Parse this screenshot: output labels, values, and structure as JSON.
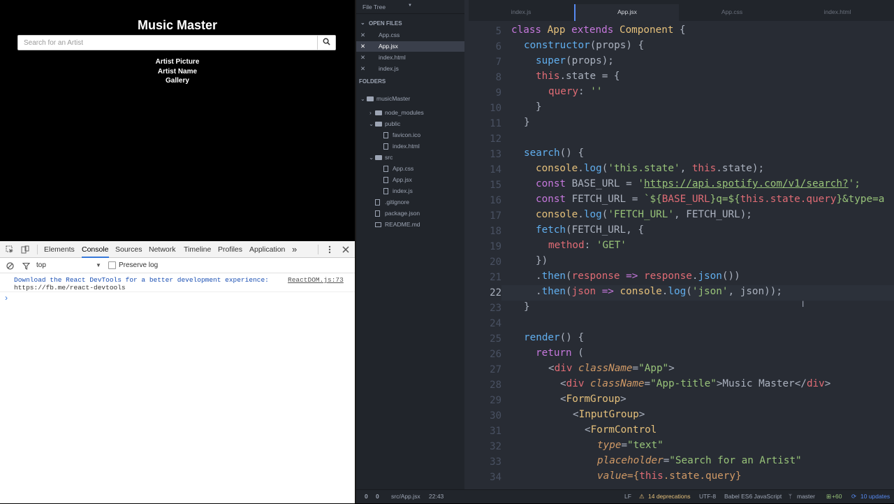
{
  "browser": {
    "app_title": "Music Master",
    "search_placeholder": "Search for an Artist",
    "lines": [
      "Artist Picture",
      "Artist Name",
      "Gallery"
    ]
  },
  "devtools": {
    "tabs": [
      "Elements",
      "Console",
      "Sources",
      "Network",
      "Timeline",
      "Profiles",
      "Application"
    ],
    "active_tab": "Console",
    "more_tabs": "»",
    "context": "top",
    "preserve_log": "Preserve log",
    "message": "Download the React DevTools for a better development experience:",
    "message_link": "https://fb.me/react-devtools",
    "message_source": "ReactDOM.js:73",
    "prompt": "›"
  },
  "editor": {
    "tree_header": "File Tree",
    "open_files_label": "OPEN FILES",
    "open_files": [
      "App.css",
      "App.jsx",
      "index.html",
      "index.js"
    ],
    "folders_label": "FOLDERS",
    "project": "musicMaster",
    "tree_items": {
      "node_modules": "node_modules",
      "public": "public",
      "favicon": "favicon.ico",
      "index_html": "index.html",
      "src": "src",
      "app_css": "App.css",
      "app_jsx": "App.jsx",
      "index_js": "index.js",
      "gitignore": ".gitignore",
      "package_json": "package.json",
      "readme": "README.md"
    },
    "tabs": [
      "index.js",
      "App.jsx",
      "App.css",
      "index.html"
    ],
    "active_tab": "App.jsx",
    "line_numbers": [
      "5",
      "6",
      "7",
      "8",
      "9",
      "10",
      "11",
      "12",
      "13",
      "14",
      "15",
      "16",
      "17",
      "18",
      "19",
      "20",
      "21",
      "22",
      "23",
      "24",
      "25",
      "26",
      "27",
      "28",
      "29",
      "30",
      "31",
      "32",
      "33",
      "34"
    ],
    "current_line": "22",
    "code": {
      "l5": [
        "class ",
        "App ",
        "extends ",
        "Component",
        " {"
      ],
      "l6": [
        "constructor",
        "(props) {"
      ],
      "l7": [
        "super",
        "(props);"
      ],
      "l8": [
        "this",
        ".state = {"
      ],
      "l9": [
        "query",
        ": ",
        "''"
      ],
      "l10": [
        "}"
      ],
      "l11": [
        "}"
      ],
      "l13": [
        "search",
        "() {"
      ],
      "l14": [
        "console",
        ".",
        "log",
        "(",
        "'this.state'",
        ", ",
        "this",
        ".state);"
      ],
      "l15": [
        "const ",
        "BASE_URL",
        " = ",
        "'",
        "https://api.spotify.com/v1/search?",
        "';"
      ],
      "l16": [
        "const ",
        "FETCH_URL",
        " = ",
        "`${",
        "BASE_URL",
        "}q=${",
        "this",
        ".state.query",
        "}&type=a"
      ],
      "l17": [
        "console",
        ".",
        "log",
        "(",
        "'FETCH_URL'",
        ", ",
        "FETCH_URL",
        ");"
      ],
      "l18": [
        "fetch",
        "(",
        "FETCH_URL",
        ", {"
      ],
      "l19": [
        "method",
        ": ",
        "'GET'"
      ],
      "l20": [
        "})"
      ],
      "l21": [
        ".",
        "then",
        "(",
        "response",
        " => ",
        "response",
        ".",
        "json",
        "())"
      ],
      "l22": [
        ".",
        "then",
        "(",
        "json",
        " => ",
        "console",
        ".",
        "log",
        "(",
        "'json'",
        ", ",
        "json",
        "));"
      ],
      "l23": [
        "}"
      ],
      "l25": [
        "render",
        "() {"
      ],
      "l26": [
        "return",
        " ("
      ],
      "l27": [
        "<",
        "div ",
        "className",
        "=",
        "\"App\"",
        ">"
      ],
      "l28": [
        "<",
        "div ",
        "className",
        "=",
        "\"App-title\"",
        ">Music Master</",
        "div",
        ">"
      ],
      "l29": [
        "<",
        "FormGroup",
        ">"
      ],
      "l30": [
        "<",
        "InputGroup",
        ">"
      ],
      "l31": [
        "<",
        "FormControl"
      ],
      "l32": [
        "type",
        "=",
        "\"text\""
      ],
      "l33": [
        "placeholder",
        "=",
        "\"Search for an Artist\""
      ],
      "l34": [
        "value",
        "={",
        "this",
        ".state.query",
        "}"
      ]
    },
    "status": {
      "errors": "0",
      "warnings": "0",
      "file": "src/App.jsx",
      "cursor": "22:43",
      "line_ending": "LF",
      "deprecations": "14 deprecations",
      "encoding": "UTF-8",
      "grammar": "Babel ES6 JavaScript",
      "branch": "master",
      "diff": "+60",
      "updates": "10 updates"
    }
  },
  "colors": {
    "editor_bg": "#282c34",
    "keyword": "#c678dd",
    "class": "#e5c07b",
    "function": "#61afef",
    "string": "#98c379",
    "variable": "#e06c75",
    "accent": "#568af2"
  }
}
